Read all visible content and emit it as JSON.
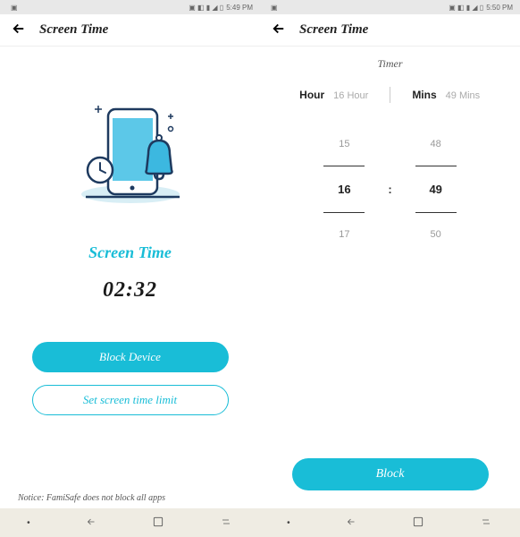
{
  "status": {
    "time_left": "5:49 PM",
    "time_right": "5:50 PM"
  },
  "left": {
    "title": "Screen Time",
    "section_title": "Screen Time",
    "time": "02:32",
    "block_label": "Block Device",
    "limit_label": "Set screen time limit",
    "notice": "Notice: FamiSafe does not block all apps"
  },
  "right": {
    "title": "Screen Time",
    "timer_label": "Timer",
    "hour_tab": "Hour",
    "hour_value": "16 Hour",
    "mins_tab": "Mins",
    "mins_value": "49 Mins",
    "hours": {
      "prev": "15",
      "sel": "16",
      "next": "17"
    },
    "mins": {
      "prev": "48",
      "sel": "49",
      "next": "50"
    },
    "block_label": "Block"
  }
}
